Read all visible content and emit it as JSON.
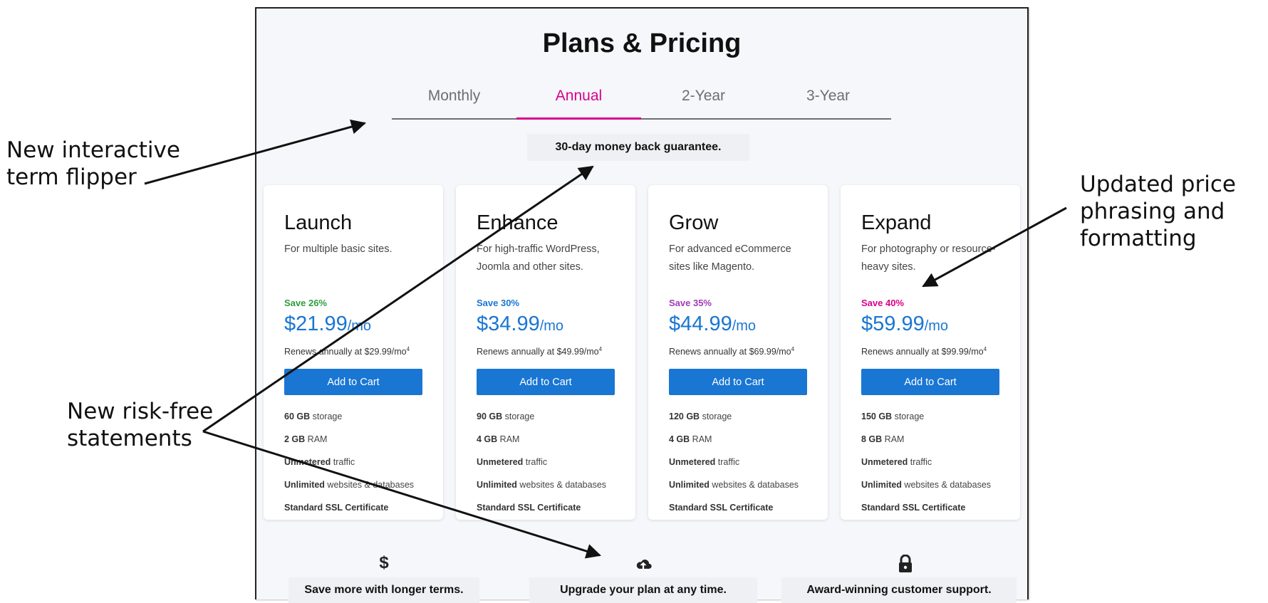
{
  "page": {
    "title": "Plans & Pricing",
    "tabs": [
      {
        "label": "Monthly",
        "active": false
      },
      {
        "label": "Annual",
        "active": true
      },
      {
        "label": "2-Year",
        "active": false
      },
      {
        "label": "3-Year",
        "active": false
      }
    ],
    "guarantee": "30-day money back guarantee.",
    "plans": [
      {
        "name": "Launch",
        "description": "For multiple basic sites.",
        "save": "Save 26%",
        "save_color": "#2e9e3f",
        "price": "$21.99",
        "per": "/mo",
        "renew": "Renews annually at $29.99/mo",
        "renew_note": "4",
        "button": "Add to Cart",
        "features": [
          {
            "bold": "60 GB",
            "rest": " storage"
          },
          {
            "bold": "2 GB",
            "rest": " RAM"
          },
          {
            "bold": "Unmetered",
            "rest": " traffic"
          },
          {
            "bold": "Unlimited",
            "rest": " websites & databases"
          },
          {
            "bold": "Standard SSL Certificate",
            "rest": ""
          }
        ]
      },
      {
        "name": "Enhance",
        "description": "For high-traffic WordPress, Joomla and other sites.",
        "save": "Save 30%",
        "save_color": "#1976d2",
        "price": "$34.99",
        "per": "/mo",
        "renew": "Renews annually at $49.99/mo",
        "renew_note": "4",
        "button": "Add to Cart",
        "features": [
          {
            "bold": "90 GB",
            "rest": " storage"
          },
          {
            "bold": "4 GB",
            "rest": " RAM"
          },
          {
            "bold": "Unmetered",
            "rest": " traffic"
          },
          {
            "bold": "Unlimited",
            "rest": " websites & databases"
          },
          {
            "bold": "Standard SSL Certificate",
            "rest": ""
          }
        ]
      },
      {
        "name": "Grow",
        "description": "For advanced eCommerce sites like Magento.",
        "save": "Save 35%",
        "save_color": "#a23ab8",
        "price": "$44.99",
        "per": "/mo",
        "renew": "Renews annually at $69.99/mo",
        "renew_note": "4",
        "button": "Add to Cart",
        "features": [
          {
            "bold": "120 GB",
            "rest": " storage"
          },
          {
            "bold": "4 GB",
            "rest": " RAM"
          },
          {
            "bold": "Unmetered",
            "rest": " traffic"
          },
          {
            "bold": "Unlimited",
            "rest": " websites & databases"
          },
          {
            "bold": "Standard SSL Certificate",
            "rest": ""
          }
        ]
      },
      {
        "name": "Expand",
        "description": "For photography or resource-heavy sites.",
        "save": "Save 40%",
        "save_color": "#d9008b",
        "price": "$59.99",
        "per": "/mo",
        "renew": "Renews annually at $99.99/mo",
        "renew_note": "4",
        "button": "Add to Cart",
        "features": [
          {
            "bold": "150 GB",
            "rest": " storage"
          },
          {
            "bold": "8 GB",
            "rest": " RAM"
          },
          {
            "bold": "Unmetered",
            "rest": " traffic"
          },
          {
            "bold": "Unlimited",
            "rest": " websites & databases"
          },
          {
            "bold": "Standard SSL Certificate",
            "rest": ""
          }
        ]
      }
    ],
    "benefits": [
      {
        "icon": "dollar-icon",
        "glyph": "$",
        "text": "Save more with longer terms."
      },
      {
        "icon": "cloud-upload-icon",
        "glyph": "☁",
        "text": "Upgrade your plan at any time."
      },
      {
        "icon": "lock-icon",
        "glyph": "🔒",
        "text": "Award-winning customer support."
      }
    ]
  },
  "annotations": [
    {
      "id": "term-flipper",
      "text": "New interactive\nterm flipper"
    },
    {
      "id": "risk-free",
      "text": "New risk-free\nstatements"
    },
    {
      "id": "price-phrasing",
      "text": "Updated price\nphrasing and\nformatting"
    }
  ],
  "colors": {
    "accent": "#d9008b",
    "brand_blue": "#1976d2",
    "background": "#f5f7fa"
  }
}
